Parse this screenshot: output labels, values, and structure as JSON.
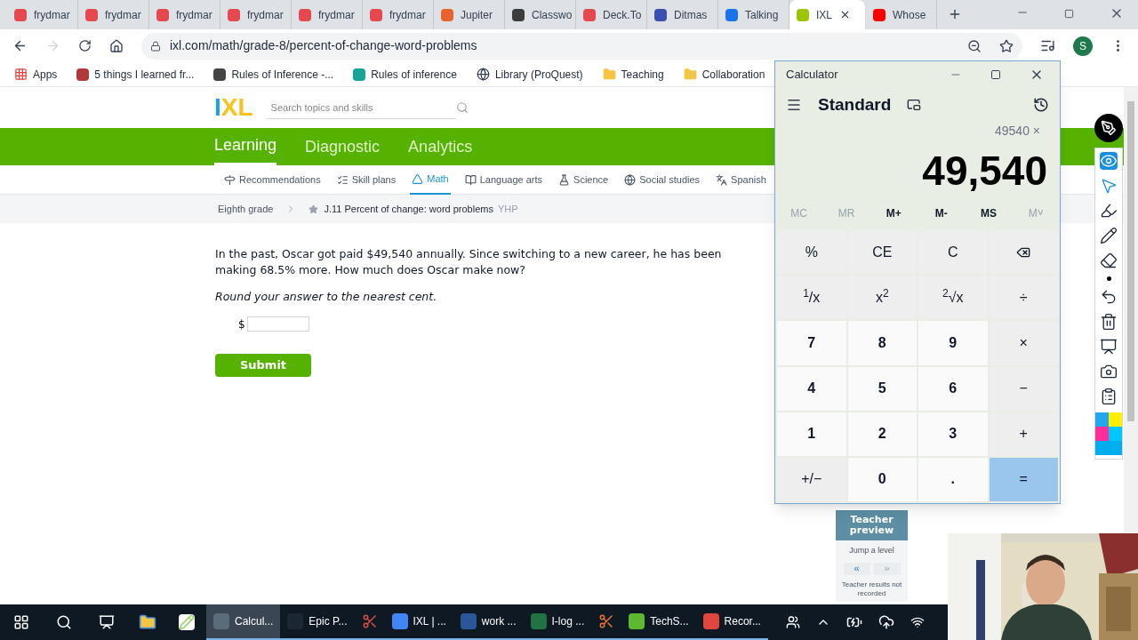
{
  "browser": {
    "tabs": [
      {
        "title": "frydmar",
        "selected": false,
        "color": "#e5484d"
      },
      {
        "title": "frydmar",
        "selected": false,
        "color": "#e5484d"
      },
      {
        "title": "frydmar",
        "selected": false,
        "color": "#e5484d"
      },
      {
        "title": "frydmar",
        "selected": false,
        "color": "#e5484d"
      },
      {
        "title": "frydmar",
        "selected": false,
        "color": "#e5484d"
      },
      {
        "title": "frydmar",
        "selected": false,
        "color": "#e5484d"
      },
      {
        "title": "Jupiter",
        "selected": false,
        "color": "#e8622c"
      },
      {
        "title": "Classwo",
        "selected": false,
        "color": "#3c3c3c"
      },
      {
        "title": "Deck.To",
        "selected": false,
        "color": "#e5484d"
      },
      {
        "title": "Ditmas",
        "selected": false,
        "color": "#3b4fb0"
      },
      {
        "title": "Talking",
        "selected": false,
        "color": "#1a73e8"
      },
      {
        "title": "IXL",
        "selected": true,
        "color": "#9cc400"
      },
      {
        "title": "Whose",
        "selected": false,
        "color": "#ff0000"
      }
    ],
    "url": "ixl.com/math/grade-8/percent-of-change-word-problems",
    "profile_initial": "S",
    "bookmarks": [
      {
        "label": "Apps",
        "kind": "apps"
      },
      {
        "label": "5 things I learned fr...",
        "kind": "site",
        "color": "#b03a3a"
      },
      {
        "label": "Rules of Inference -...",
        "kind": "site",
        "color": "#444444"
      },
      {
        "label": "Rules of inference",
        "kind": "site",
        "color": "#16a596"
      },
      {
        "label": "Library (ProQuest)",
        "kind": "globe"
      },
      {
        "label": "Teaching",
        "kind": "folder"
      },
      {
        "label": "Collaboration",
        "kind": "folder"
      }
    ]
  },
  "page": {
    "logo": "IXL",
    "search_placeholder": "Search topics and skills",
    "nav": [
      {
        "label": "Learning",
        "selected": true
      },
      {
        "label": "Diagnostic",
        "selected": false
      },
      {
        "label": "Analytics",
        "selected": false
      }
    ],
    "subjects": [
      {
        "label": "Recommendations",
        "selected": false
      },
      {
        "label": "Skill plans",
        "selected": false
      },
      {
        "label": "Math",
        "selected": true
      },
      {
        "label": "Language arts",
        "selected": false
      },
      {
        "label": "Science",
        "selected": false
      },
      {
        "label": "Social studies",
        "selected": false
      },
      {
        "label": "Spanish",
        "selected": false
      }
    ],
    "breadcrumb": {
      "grade": "Eighth grade",
      "skill": "J.11 Percent of change: word problems",
      "code": "YHP"
    },
    "question": "In the past, Oscar got paid $49,540 annually. Since switching to a new career, he has been making 68.5% more. How much does Oscar make now?",
    "instruction": "Round your answer to the nearest cent.",
    "answer_prefix": "$",
    "submit": "Submit",
    "teacher_panel": {
      "title": "Teacher preview",
      "jump": "Jump a level",
      "prev": {
        "label": "«",
        "disabled": false
      },
      "next": {
        "label": "»",
        "disabled": true
      },
      "note": "Teacher results not recorded"
    }
  },
  "calculator": {
    "title": "Calculator",
    "mode": "Standard",
    "expression": "49540 ×",
    "display": "49,540",
    "memory": [
      {
        "label": "MC",
        "disabled": true
      },
      {
        "label": "MR",
        "disabled": true
      },
      {
        "label": "M+",
        "disabled": false
      },
      {
        "label": "M-",
        "disabled": false
      },
      {
        "label": "MS",
        "disabled": false
      },
      {
        "label": "M˅",
        "disabled": true
      }
    ],
    "keys": [
      {
        "label": "%",
        "kind": "function"
      },
      {
        "label": "CE",
        "kind": "function"
      },
      {
        "label": "C",
        "kind": "function"
      },
      {
        "kind": "backspace"
      },
      {
        "label": "$^{1}$/x",
        "kind": "function"
      },
      {
        "label": "x$^{2}$",
        "kind": "function"
      },
      {
        "label": "$^{2}$√x",
        "kind": "function"
      },
      {
        "label": "÷",
        "kind": "function"
      },
      {
        "label": "7",
        "kind": "digit"
      },
      {
        "label": "8",
        "kind": "digit"
      },
      {
        "label": "9",
        "kind": "digit"
      },
      {
        "label": "×",
        "kind": "function"
      },
      {
        "label": "4",
        "kind": "digit"
      },
      {
        "label": "5",
        "kind": "digit"
      },
      {
        "label": "6",
        "kind": "digit"
      },
      {
        "label": "−",
        "kind": "function"
      },
      {
        "label": "1",
        "kind": "digit"
      },
      {
        "label": "2",
        "kind": "digit"
      },
      {
        "label": "3",
        "kind": "digit"
      },
      {
        "label": "+",
        "kind": "function"
      },
      {
        "label": "+/−",
        "kind": "function"
      },
      {
        "label": "0",
        "kind": "digit"
      },
      {
        "label": ".",
        "kind": "digit"
      },
      {
        "label": "=",
        "kind": "equals"
      }
    ]
  },
  "taskbar": {
    "apps": [
      {
        "label": "Calcul...",
        "color": "#5a6b7a",
        "selected": true
      },
      {
        "label": "Epic P...",
        "color": "#1d2733",
        "selected": false
      },
      {
        "color": "#d94c4c",
        "selected": false
      },
      {
        "label": "IXL | ...",
        "color": "#4285f4",
        "selected": false
      },
      {
        "label": "work ...",
        "color": "#2b579a",
        "selected": false
      },
      {
        "label": "I-log ...",
        "color": "#217346",
        "selected": false
      },
      {
        "color": "#e8742c",
        "selected": false
      },
      {
        "label": "TechS...",
        "color": "#5cb82e",
        "selected": false
      },
      {
        "label": "Recor...",
        "color": "#e0463d",
        "selected": false
      }
    ]
  }
}
